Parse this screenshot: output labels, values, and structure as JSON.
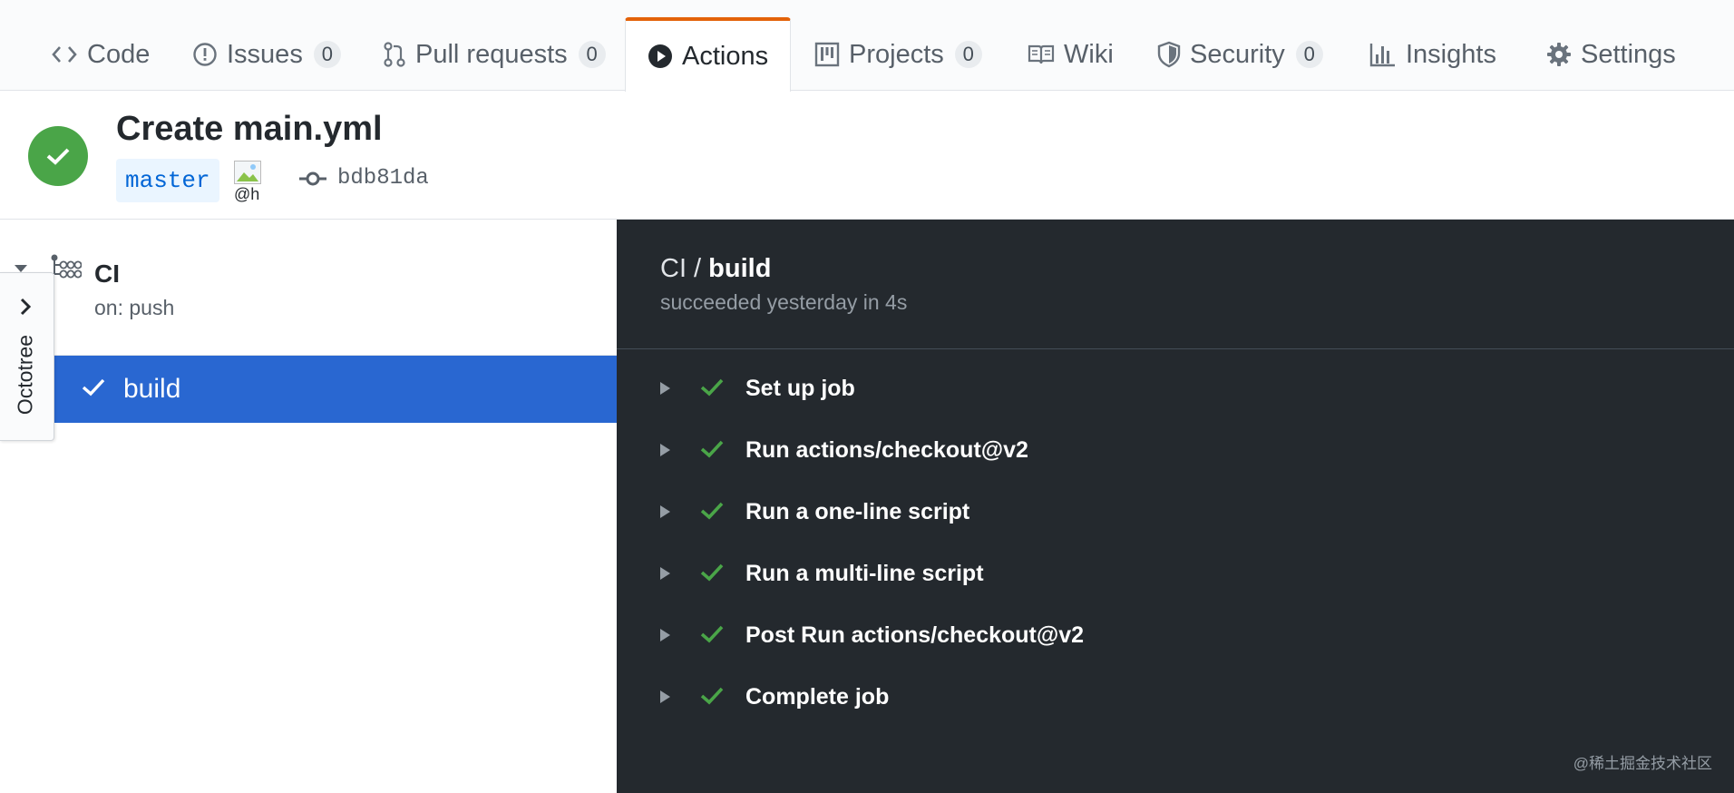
{
  "tabs": [
    {
      "label": "Code",
      "icon": "code-icon"
    },
    {
      "label": "Issues",
      "count": "0",
      "icon": "issue-icon"
    },
    {
      "label": "Pull requests",
      "count": "0",
      "icon": "pull-request-icon"
    },
    {
      "label": "Actions",
      "icon": "play-icon",
      "selected": true
    },
    {
      "label": "Projects",
      "count": "0",
      "icon": "project-icon"
    },
    {
      "label": "Wiki",
      "icon": "book-icon"
    },
    {
      "label": "Security",
      "count": "0",
      "icon": "shield-icon"
    },
    {
      "label": "Insights",
      "icon": "graph-icon"
    },
    {
      "label": "Settings",
      "icon": "gear-icon"
    }
  ],
  "run": {
    "title": "Create main.yml",
    "status": "success",
    "branch": "master",
    "avatar_alt": "@h",
    "commit": "bdb81da"
  },
  "sidebar": {
    "workflow": {
      "name": "CI",
      "trigger": "on: push"
    },
    "jobs": [
      {
        "label": "build",
        "status": "success",
        "selected": true
      }
    ]
  },
  "octotree": {
    "label": "Octotree"
  },
  "log": {
    "workflow": "CI",
    "separator": " / ",
    "job": "build",
    "summary": "succeeded yesterday in 4s",
    "steps": [
      {
        "name": "Set up job"
      },
      {
        "name": "Run actions/checkout@v2"
      },
      {
        "name": "Run a one-line script"
      },
      {
        "name": "Run a multi-line script"
      },
      {
        "name": "Post Run actions/checkout@v2"
      },
      {
        "name": "Complete job"
      }
    ]
  },
  "watermark": "@稀土掘金技术社区",
  "colors": {
    "accent_orange": "#e36209",
    "success_green": "#4aa548",
    "selected_blue": "#2967d1",
    "dark_panel": "#24292e"
  }
}
